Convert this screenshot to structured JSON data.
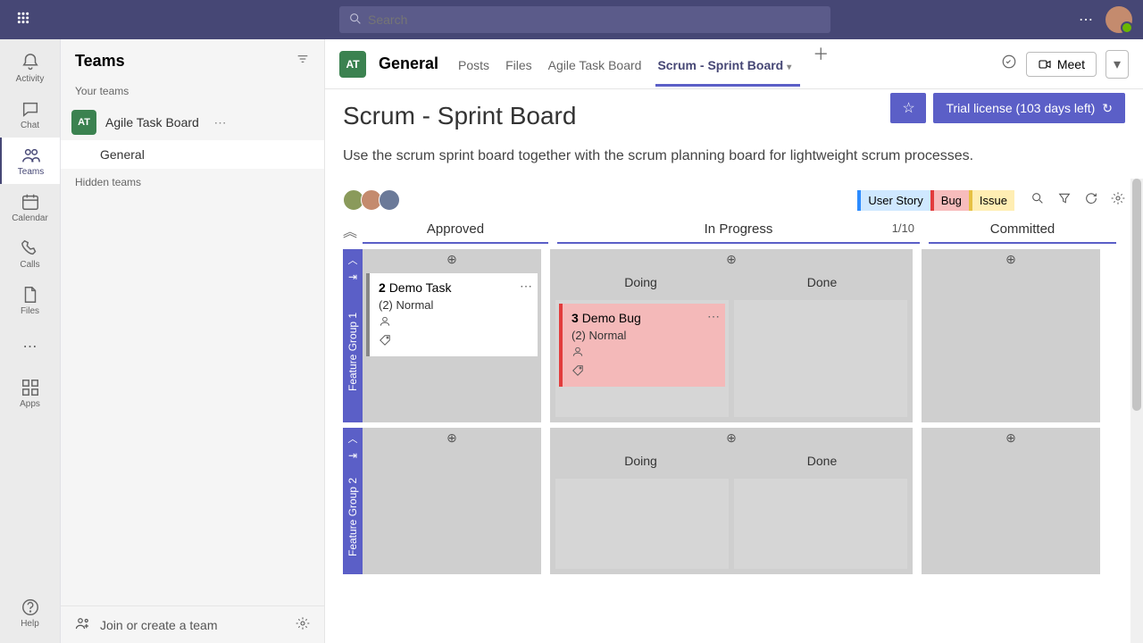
{
  "topbar": {
    "search_placeholder": "Search"
  },
  "rail": {
    "activity": "Activity",
    "chat": "Chat",
    "teams": "Teams",
    "calendar": "Calendar",
    "calls": "Calls",
    "files": "Files",
    "apps": "Apps",
    "help": "Help"
  },
  "panel": {
    "title": "Teams",
    "section_your": "Your teams",
    "team_badge": "AT",
    "team_name": "Agile Task Board",
    "channel_general": "General",
    "section_hidden": "Hidden teams",
    "join": "Join or create a team"
  },
  "header": {
    "team_badge": "AT",
    "channel": "General",
    "tabs": {
      "posts": "Posts",
      "files": "Files",
      "agile": "Agile Task Board",
      "scrum": "Scrum - Sprint Board"
    },
    "meet": "Meet"
  },
  "board": {
    "title": "Scrum - Sprint Board",
    "trial": "Trial license (103 days left)",
    "desc": "Use the scrum sprint board together with the scrum planning board for lightweight scrum processes.",
    "pills": {
      "story": "User Story",
      "bug": "Bug",
      "issue": "Issue"
    },
    "columns": {
      "approved": "Approved",
      "inprogress": "In Progress",
      "inprogress_count": "1/10",
      "committed": "Committed",
      "doing": "Doing",
      "done": "Done"
    },
    "lanes": {
      "g1": "Feature Group 1",
      "g2": "Feature Group 2"
    },
    "cards": {
      "task": {
        "id": "2",
        "title": "Demo Task",
        "priority": "(2) Normal"
      },
      "bug": {
        "id": "3",
        "title": "Demo Bug",
        "priority": "(2) Normal"
      }
    }
  }
}
